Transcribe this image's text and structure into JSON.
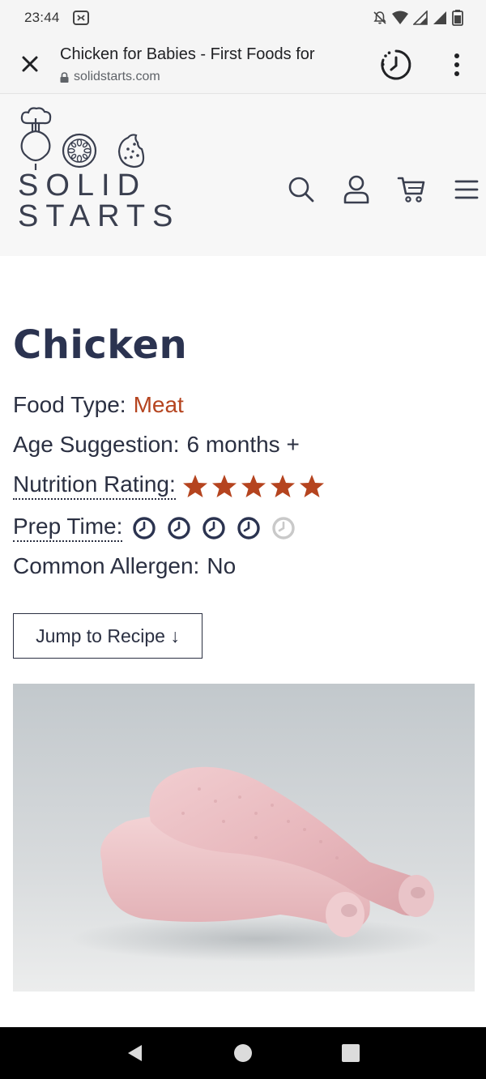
{
  "status_bar": {
    "time": "23:44",
    "icons": [
      "screenshot-icon",
      "notifications-off-icon",
      "wifi-icon",
      "signal-icon",
      "signal-icon",
      "battery-icon"
    ]
  },
  "browser": {
    "page_title": "Chicken for Babies - First Foods for",
    "url": "solidstarts.com",
    "icons": [
      "close-icon",
      "lock-icon",
      "history-icon",
      "more-vert-icon"
    ]
  },
  "site_header": {
    "logo_line1": "SOLID",
    "logo_line2": "STARTS",
    "icons": [
      "search-icon",
      "account-icon",
      "cart-icon",
      "menu-icon"
    ]
  },
  "food": {
    "title": "Chicken",
    "food_type_label": "Food Type:",
    "food_type_value": "Meat",
    "age_label": "Age Suggestion:",
    "age_value": "6 months +",
    "nutrition_label": "Nutrition Rating:",
    "nutrition_rating": 5,
    "nutrition_max": 5,
    "prep_label": "Prep Time:",
    "prep_time": 4,
    "prep_max": 5,
    "allergen_label": "Common Allergen:",
    "allergen_value": "No",
    "jump_button": "Jump to Recipe ↓"
  },
  "colors": {
    "accent": "#b5441f",
    "text": "#2b3042",
    "title": "#2b3350",
    "clock_inactive": "#c9c9c9"
  },
  "nav_bar": {
    "icons": [
      "back-icon",
      "home-icon",
      "recents-icon"
    ]
  }
}
